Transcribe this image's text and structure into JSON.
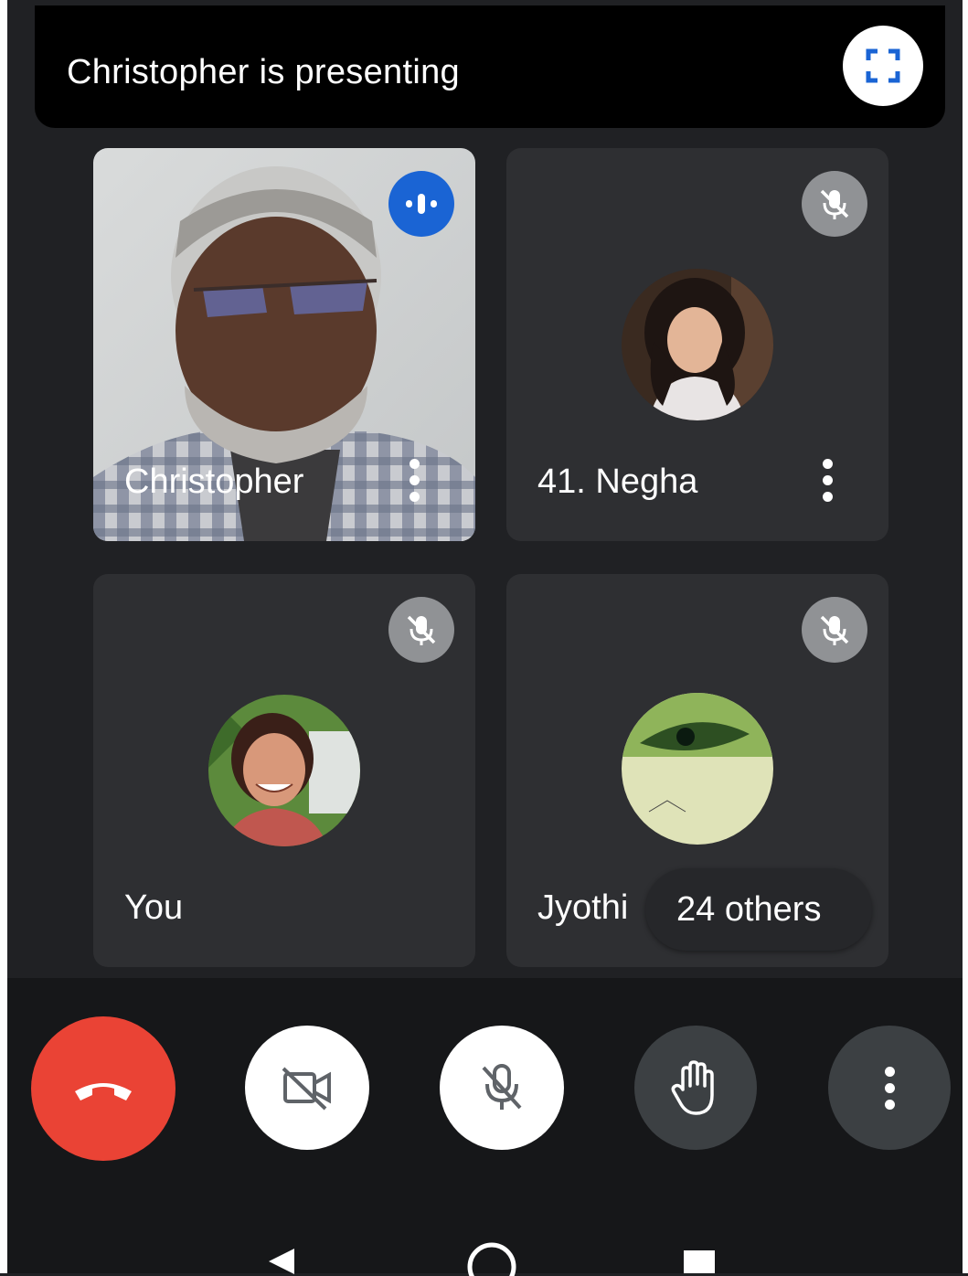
{
  "banner": {
    "text": "Christopher is presenting",
    "fullscreen_icon": "fullscreen-icon"
  },
  "tiles": [
    {
      "name": "Christopher",
      "status": "speaking",
      "has_video": true
    },
    {
      "name": "41. Negha",
      "status": "muted",
      "has_video": false
    },
    {
      "name": "You",
      "status": "muted",
      "has_video": false
    },
    {
      "name": "Jyothi",
      "status": "muted",
      "has_video": false
    }
  ],
  "others": {
    "label": "24 others"
  },
  "controls": {
    "end_call": "end-call-icon",
    "camera": "camera-off-icon",
    "mic": "mic-off-icon",
    "raise_hand": "raise-hand-icon",
    "more": "more-options-icon"
  },
  "colors": {
    "end_call": "#ea4335",
    "speaking_badge": "#1a64d4",
    "tile_bg": "#2e2f32",
    "background": "#202124"
  }
}
